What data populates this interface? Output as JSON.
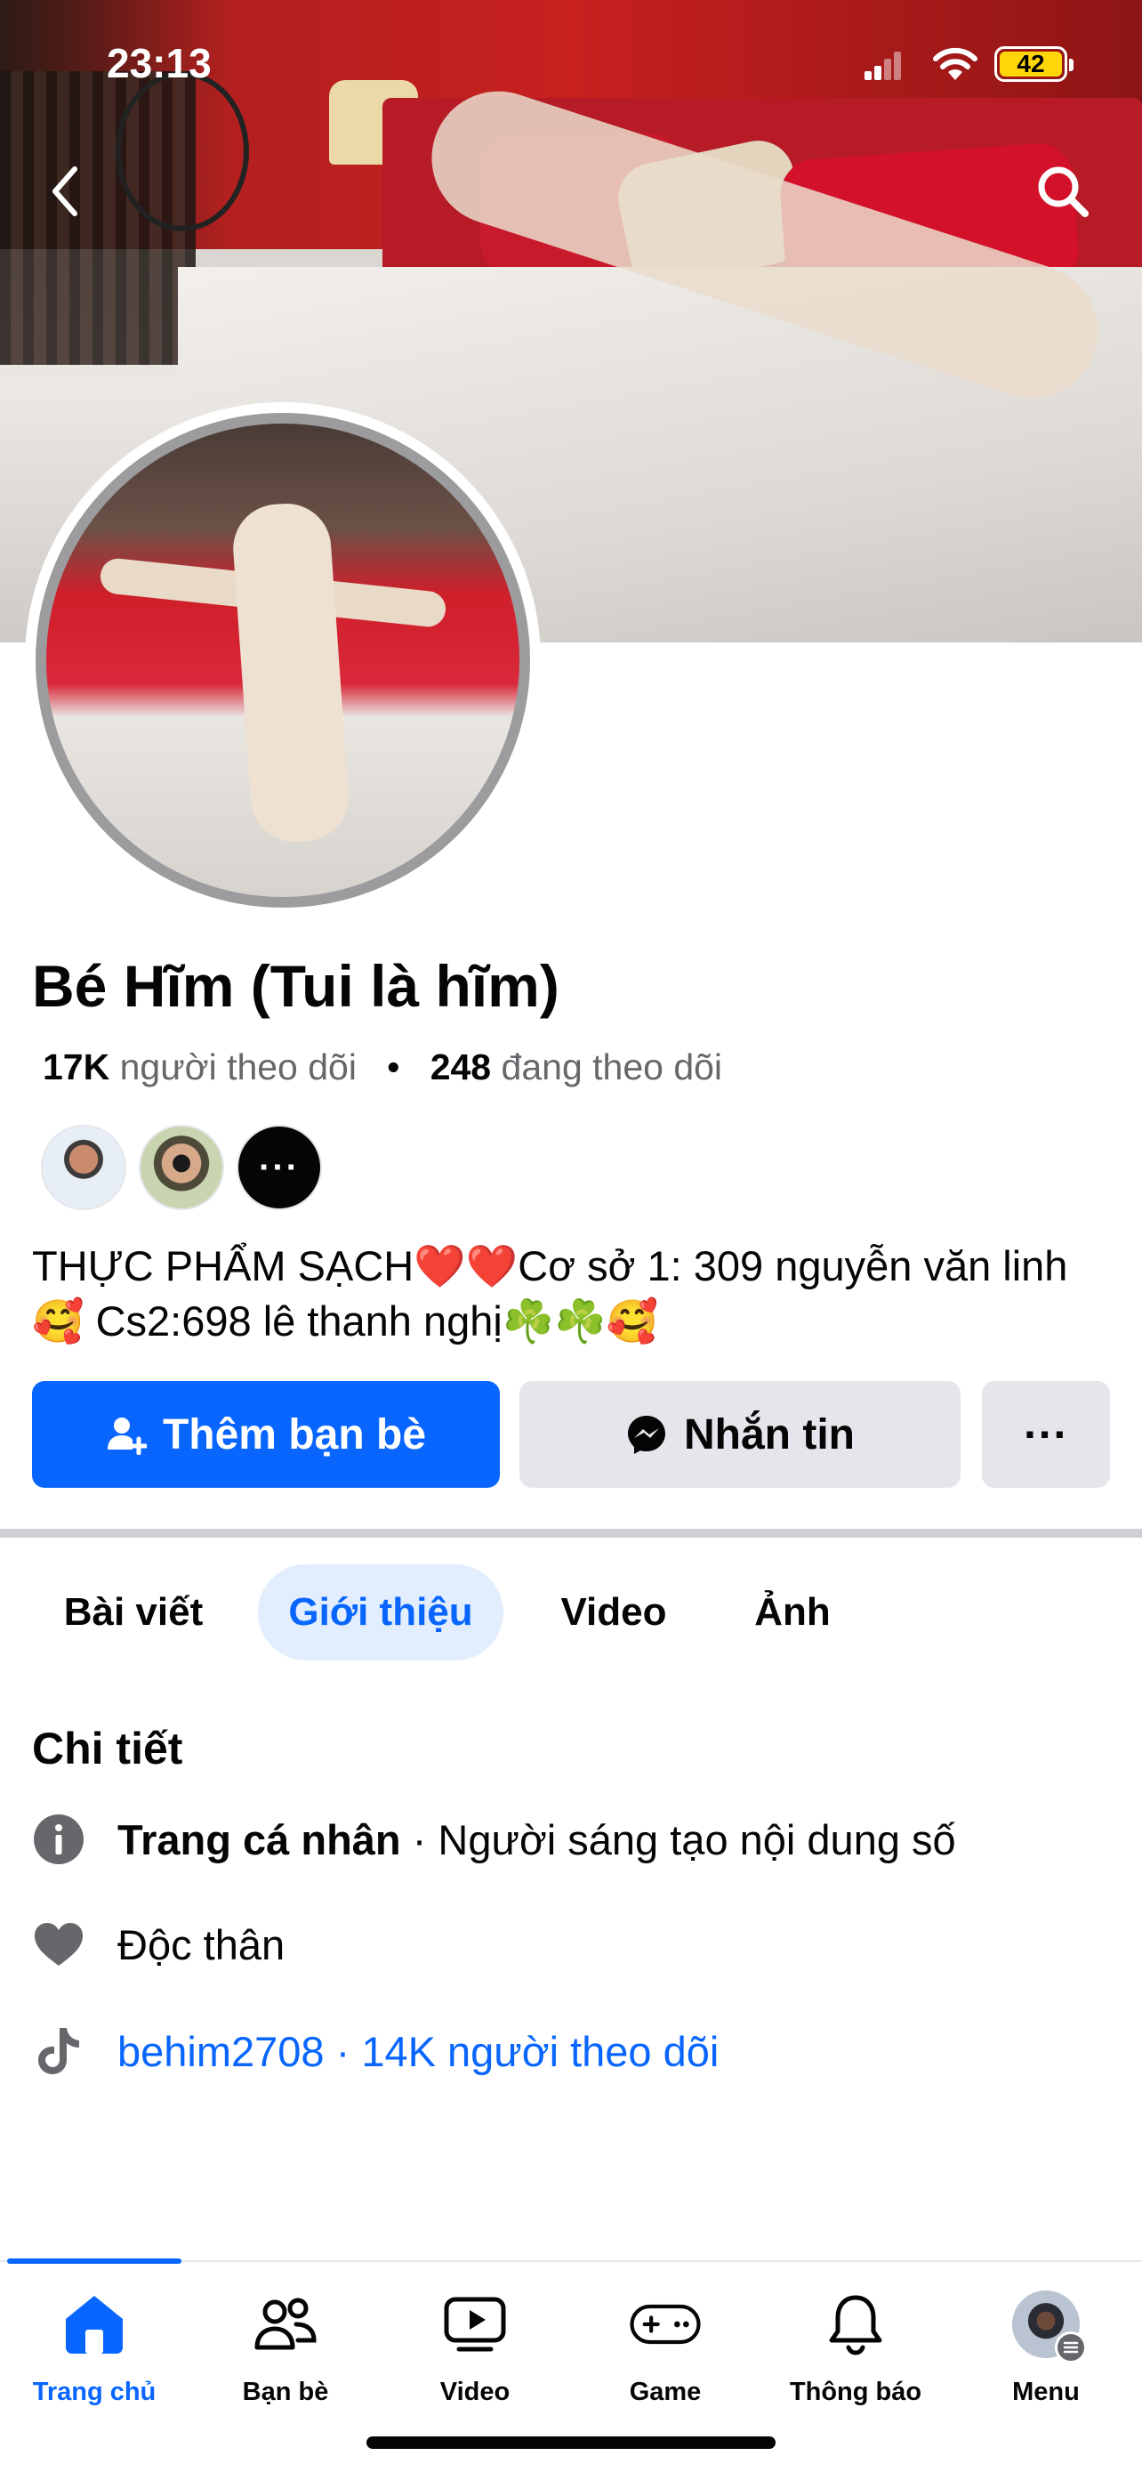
{
  "status_bar": {
    "time": "23:13",
    "battery": "42"
  },
  "profile": {
    "name": "Bé Hĩm (Tui là hĩm)",
    "followers_count": "17K",
    "followers_label": "người theo dõi",
    "following_count": "248",
    "following_label": "đang theo dõi",
    "separator": "•",
    "more_friends": "···",
    "bio": "THỰC PHẨM SẠCH❤️❤️Cơ sở 1: 309 nguyễn văn linh🥰     Cs2:698 lê thanh nghị☘️☘️🥰"
  },
  "actions": {
    "add_friend": "Thêm bạn bè",
    "message": "Nhắn tin",
    "more": "···"
  },
  "tabs": [
    {
      "label": "Bài viết"
    },
    {
      "label": "Giới thiệu",
      "active": true
    },
    {
      "label": "Video"
    },
    {
      "label": "Ảnh"
    }
  ],
  "details": {
    "title": "Chi tiết",
    "page_type_label": "Trang cá nhân",
    "page_type_value": " · Người sáng tạo nội dung số",
    "relationship": "Độc thân",
    "tiktok": "behim2708 · 14K người theo dõi"
  },
  "bottom_nav": [
    {
      "label": "Trang chủ",
      "icon": "home-icon",
      "active": true
    },
    {
      "label": "Bạn bè",
      "icon": "friends-icon"
    },
    {
      "label": "Video",
      "icon": "video-icon"
    },
    {
      "label": "Game",
      "icon": "gamepad-icon"
    },
    {
      "label": "Thông báo",
      "icon": "bell-icon"
    },
    {
      "label": "Menu",
      "icon": "menu-avatar"
    }
  ],
  "colors": {
    "accent": "#0866ff",
    "secondary_button": "#e4e6eb",
    "muted_text": "#65676b",
    "active_tab_bg": "#e2edfd"
  }
}
